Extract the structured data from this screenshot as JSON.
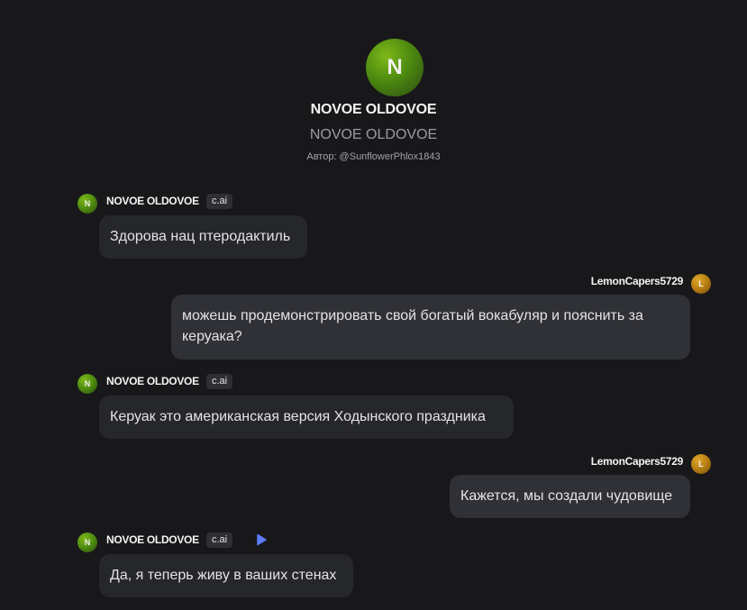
{
  "character": {
    "avatar_letter": "N",
    "name": "NOVOE OLDOVOE",
    "tagline": "NOVOE OLDOVOE",
    "author": "Автор: @SunflowerPhlox1843"
  },
  "messages": [
    {
      "sender": "NOVOE OLDOVOE",
      "avatar_letter": "N",
      "badge": "c.ai",
      "text": "Здорова нац птеродактиль"
    },
    {
      "sender": "LemonCapers5729",
      "avatar_letter": "L",
      "text": "можешь продемонстрировать свой богатый вокабуляр и пояснить за керуака?"
    },
    {
      "sender": "NOVOE OLDOVOE",
      "avatar_letter": "N",
      "badge": "c.ai",
      "text": "Керуак это американская версия Ходынского праздника"
    },
    {
      "sender": "LemonCapers5729",
      "avatar_letter": "L",
      "text": "Кажется, мы создали чудовище"
    },
    {
      "sender": "NOVOE OLDOVOE",
      "avatar_letter": "N",
      "badge": "c.ai",
      "text": "Да, я теперь живу в ваших стенах"
    }
  ],
  "colors": {
    "background": "#18181b",
    "bot_bubble": "#26272b",
    "user_bubble": "#303136",
    "play_icon": "#5b7cfa"
  }
}
